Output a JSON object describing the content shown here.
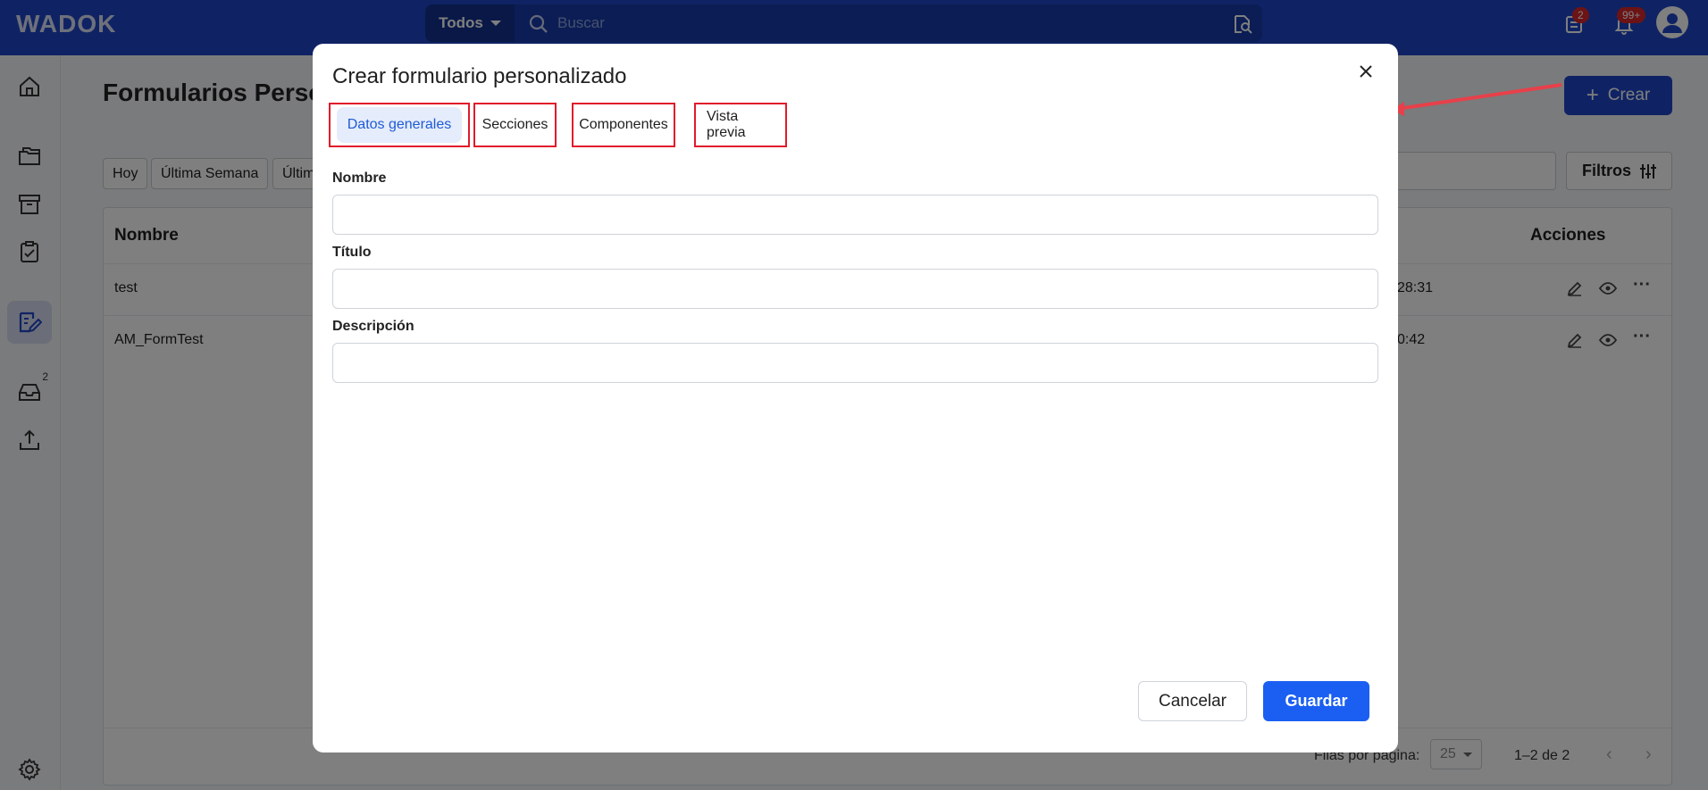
{
  "colors": {
    "brand": "#1e46c9",
    "primary_button": "#1a5ff2",
    "highlight_box": "#e01b2a",
    "badge": "#d8262a"
  },
  "topbar": {
    "logo": "WADOK",
    "scope": "Todos",
    "search_placeholder": "Buscar",
    "tasks_badge": "2",
    "notifications_badge": "99+"
  },
  "sidebar": {
    "items": [
      {
        "icon": "home-icon"
      },
      {
        "icon": "folders-icon"
      },
      {
        "icon": "archive-icon"
      },
      {
        "icon": "clipboard-check-icon"
      },
      {
        "icon": "form-edit-icon",
        "active": true
      },
      {
        "icon": "inbox-icon",
        "badge": "2"
      },
      {
        "icon": "upload-icon"
      },
      {
        "icon": "settings-icon"
      }
    ],
    "inbox_badge": "2"
  },
  "main": {
    "title": "Formularios Perso",
    "create_label": "Crear",
    "chips": [
      "Hoy",
      "Última Semana",
      "Últim"
    ],
    "filters_label": "Filtros",
    "table": {
      "col_name": "Nombre",
      "col_actions": "Acciones",
      "rows": [
        {
          "name": "test",
          "time": "28:31"
        },
        {
          "name": "AM_FormTest",
          "time": "0:42"
        }
      ]
    },
    "footer": {
      "rows_per_page_label": "Filas por página:",
      "rows_per_page": "25",
      "range": "1–2 de 2"
    }
  },
  "modal": {
    "title": "Crear formulario personalizado",
    "tabs": [
      "Datos generales",
      "Secciones",
      "Componentes",
      "Vista previa"
    ],
    "fields": {
      "nombre_label": "Nombre",
      "nombre_value": "",
      "titulo_label": "Título",
      "titulo_value": "",
      "descripcion_label": "Descripción",
      "descripcion_value": ""
    },
    "cancel_label": "Cancelar",
    "save_label": "Guardar"
  }
}
